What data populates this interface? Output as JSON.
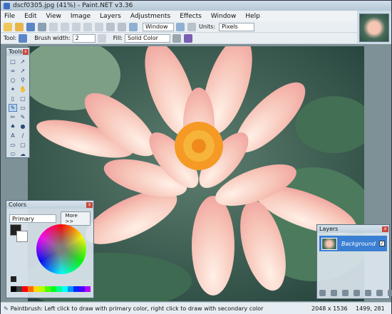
{
  "window": {
    "title": "dscf0305.jpg (41%) - Paint.NET v3.36"
  },
  "menu": [
    "File",
    "Edit",
    "View",
    "Image",
    "Layers",
    "Adjustments",
    "Effects",
    "Window",
    "Help"
  ],
  "toolbar": {
    "window_label": "Window",
    "units_label": "Units:",
    "units_value": "Pixels"
  },
  "toolbar2": {
    "tool_label": "Tool:",
    "brush_width_label": "Brush width:",
    "brush_width_value": "2",
    "fill_label": "Fill:",
    "fill_value": "Solid Color"
  },
  "tools_panel": {
    "title": "Tools"
  },
  "colors_panel": {
    "title": "Colors",
    "mode": "Primary",
    "more_button": "More >>"
  },
  "layers_panel": {
    "title": "Layers",
    "layer_name": "Background"
  },
  "status": {
    "hint": "Paintbrush: Left click to draw with primary color, right click to draw with secondary color",
    "image_size": "2048 x 1536",
    "cursor_pos": "1499, 281"
  },
  "palette_colors": [
    "#000000",
    "#404040",
    "#ff0000",
    "#ff6a00",
    "#ffd800",
    "#b6ff00",
    "#4cff00",
    "#00ff21",
    "#00ff90",
    "#00ffff",
    "#0094ff",
    "#0026ff",
    "#4800ff",
    "#b200ff",
    "#ff00dc",
    "#ff006e",
    "#ffffff",
    "#808080"
  ]
}
